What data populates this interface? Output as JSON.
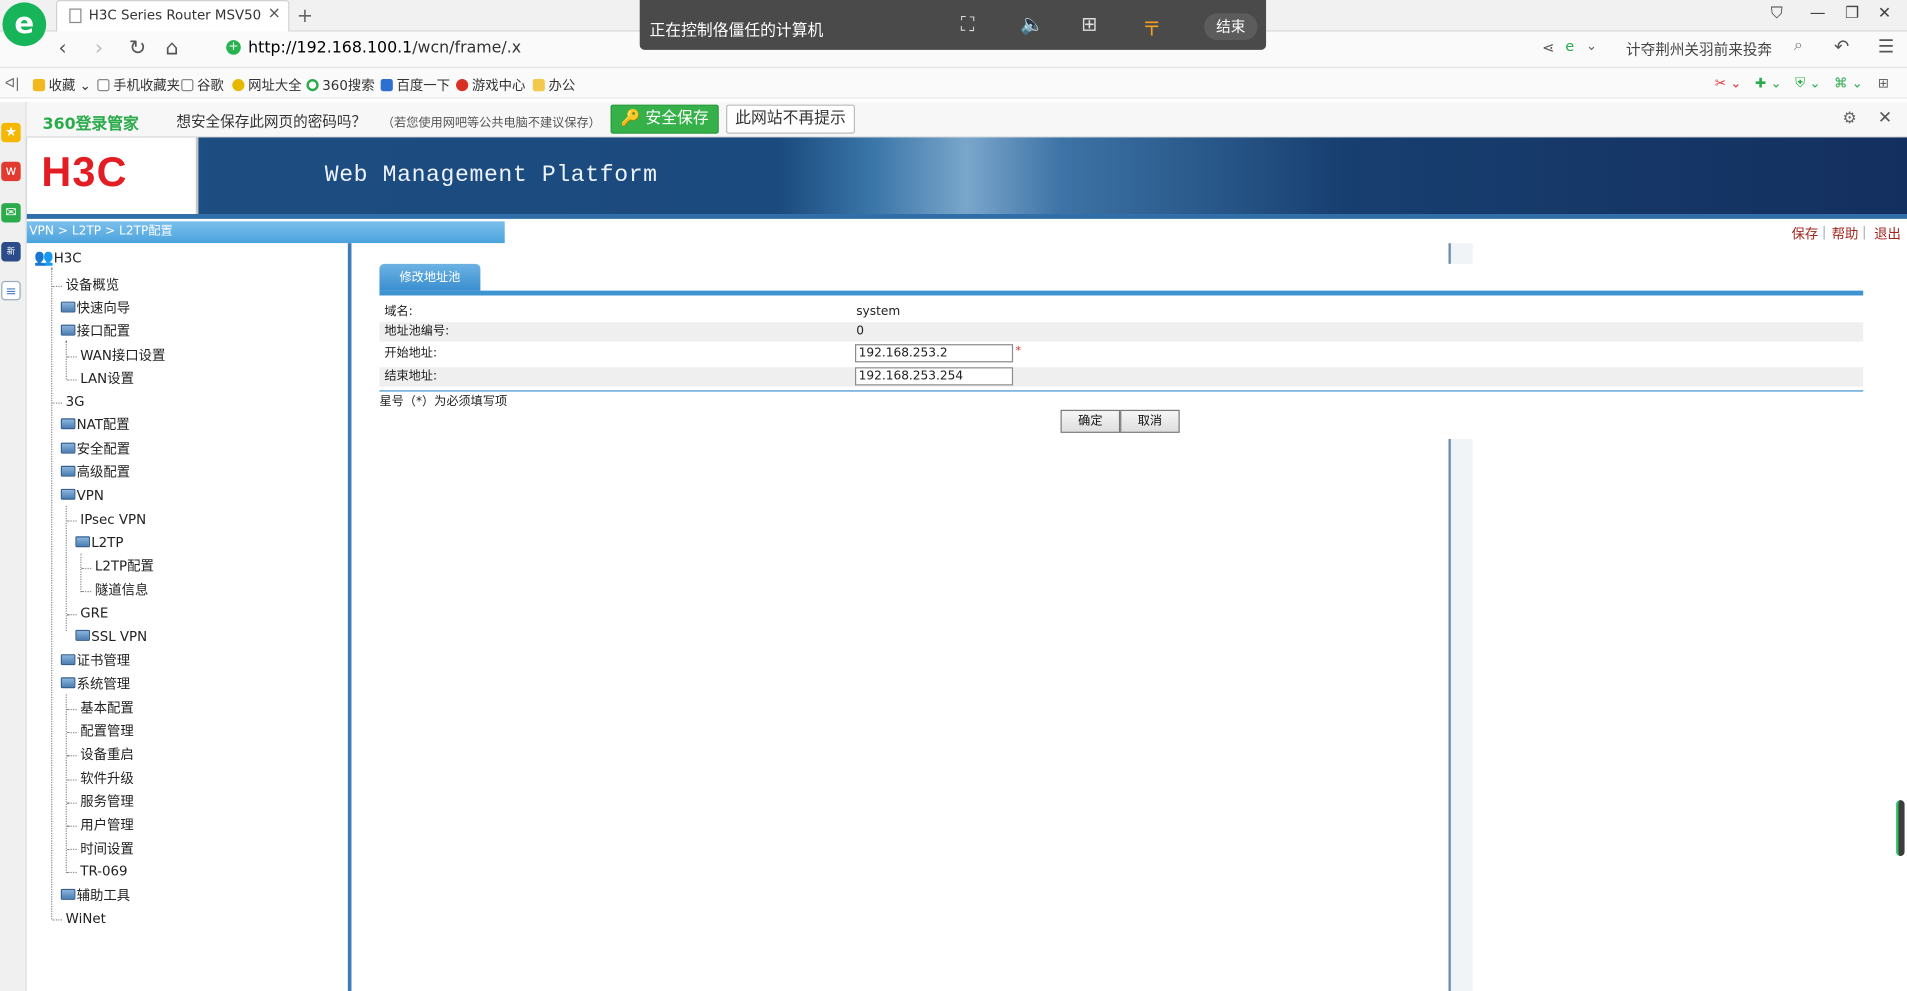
{
  "browser": {
    "tab_title": "H3C Series Router MSV50",
    "url_host": "http://192.168.100.1",
    "url_path": "/wcn/frame/.x",
    "search_text": "计夺荆州关羽前来投奔",
    "bookmarks": [
      "收藏",
      "手机收藏夹",
      "谷歌",
      "网址大全",
      "360搜索",
      "百度一下",
      "游戏中心",
      "办公"
    ]
  },
  "remote_bar": {
    "text": "正在控制佫僵任的计算机",
    "end_label": "结束"
  },
  "password_bar": {
    "brand": "360登录管家",
    "question": "想安全保存此网页的密码吗？",
    "note": "（若您使用网吧等公共电脑不建议保存）",
    "save_label": "安全保存",
    "no_prompt_label": "此网站不再提示"
  },
  "header": {
    "logo": "H3C",
    "platform_title": "Web Management Platform"
  },
  "breadcrumb": "VPN > L2TP > L2TP配置",
  "top_links": {
    "save": "保存",
    "help": "帮助",
    "logout": "退出"
  },
  "tree": {
    "root": "H3C",
    "items": [
      "设备概览",
      "快速向导",
      "接口配置",
      "WAN接口设置",
      "LAN设置",
      "3G",
      "NAT配置",
      "安全配置",
      "高级配置",
      "VPN",
      "IPsec VPN",
      "L2TP",
      "L2TP配置",
      "隧道信息",
      "GRE",
      "SSL VPN",
      "证书管理",
      "系统管理",
      "基本配置",
      "配置管理",
      "设备重启",
      "软件升级",
      "服务管理",
      "用户管理",
      "时间设置",
      "TR-069",
      "辅助工具",
      "WiNet"
    ]
  },
  "form": {
    "tab_label": "修改地址池",
    "domain_label": "域名:",
    "domain_value": "system",
    "pool_id_label": "地址池编号:",
    "pool_id_value": "0",
    "start_label": "开始地址:",
    "start_value": "192.168.253.2",
    "end_label": "结束地址:",
    "end_value": "192.168.253.254",
    "required_note": "星号（*）为必须填写项",
    "ok_label": "确定",
    "cancel_label": "取消"
  }
}
